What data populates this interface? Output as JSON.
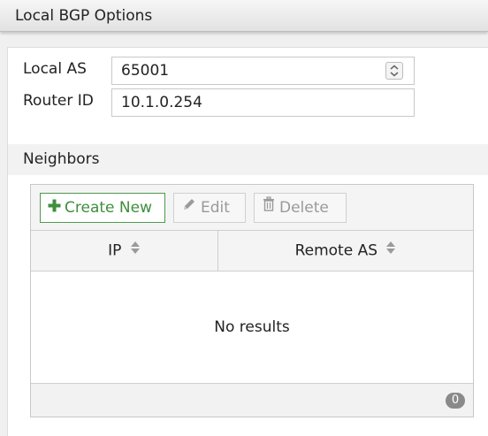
{
  "section": {
    "title": "Local BGP Options"
  },
  "form": {
    "local_as": {
      "label": "Local AS",
      "value": "65001"
    },
    "router_id": {
      "label": "Router ID",
      "value": "10.1.0.254"
    }
  },
  "neighbors": {
    "title": "Neighbors",
    "toolbar": {
      "create_label": "Create New",
      "edit_label": "Edit",
      "delete_label": "Delete"
    },
    "columns": [
      "IP",
      "Remote AS"
    ],
    "empty_text": "No results",
    "count": "0"
  },
  "colors": {
    "create_green": "#3d8f3d",
    "disabled_gray": "#9a9a9a",
    "badge_gray": "#8a8a8a"
  },
  "icons": {
    "create": "plus-icon",
    "edit": "pencil-icon",
    "delete": "trash-icon",
    "sort": "sort-icon",
    "spinner": "spinner-icon"
  }
}
